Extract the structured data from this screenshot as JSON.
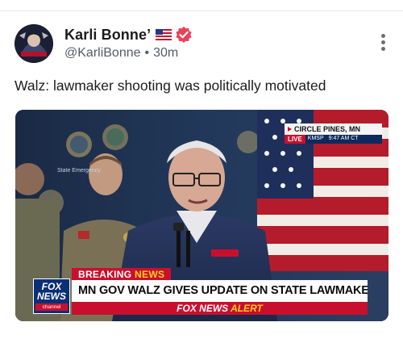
{
  "post": {
    "display_name": "Karli Bonne’",
    "handle": "@KarliBonne",
    "separator": "•",
    "time_ago": "30m",
    "text": "Walz: lawmaker shooting was politically motivated"
  },
  "icons": {
    "flag": "us-flag-icon",
    "verified": "verified-badge-icon",
    "more": "more-vertical-icon",
    "avatar": "avatar"
  },
  "colors": {
    "verified": "#e8425a",
    "fox_red": "#c8102e",
    "fox_blue": "#0a2f76",
    "accent_yellow": "#ffd21f"
  },
  "broadcast": {
    "location": "CIRCLE PINES, MN",
    "live_label": "LIVE",
    "station": "KMSP",
    "time": "9:47 AM CT",
    "breaking_label_1": "BREAKING",
    "breaking_label_2": "NEWS",
    "headline": "MN GOV WALZ GIVES UPDATE ON STATE LAWMAKERS SHOT",
    "alert_brand": "FOX NEWS",
    "alert_word": "ALERT",
    "logo_line1": "FOX",
    "logo_line2": "NEWS",
    "logo_line3": "channel",
    "backdrop_text": "State Emergency"
  }
}
